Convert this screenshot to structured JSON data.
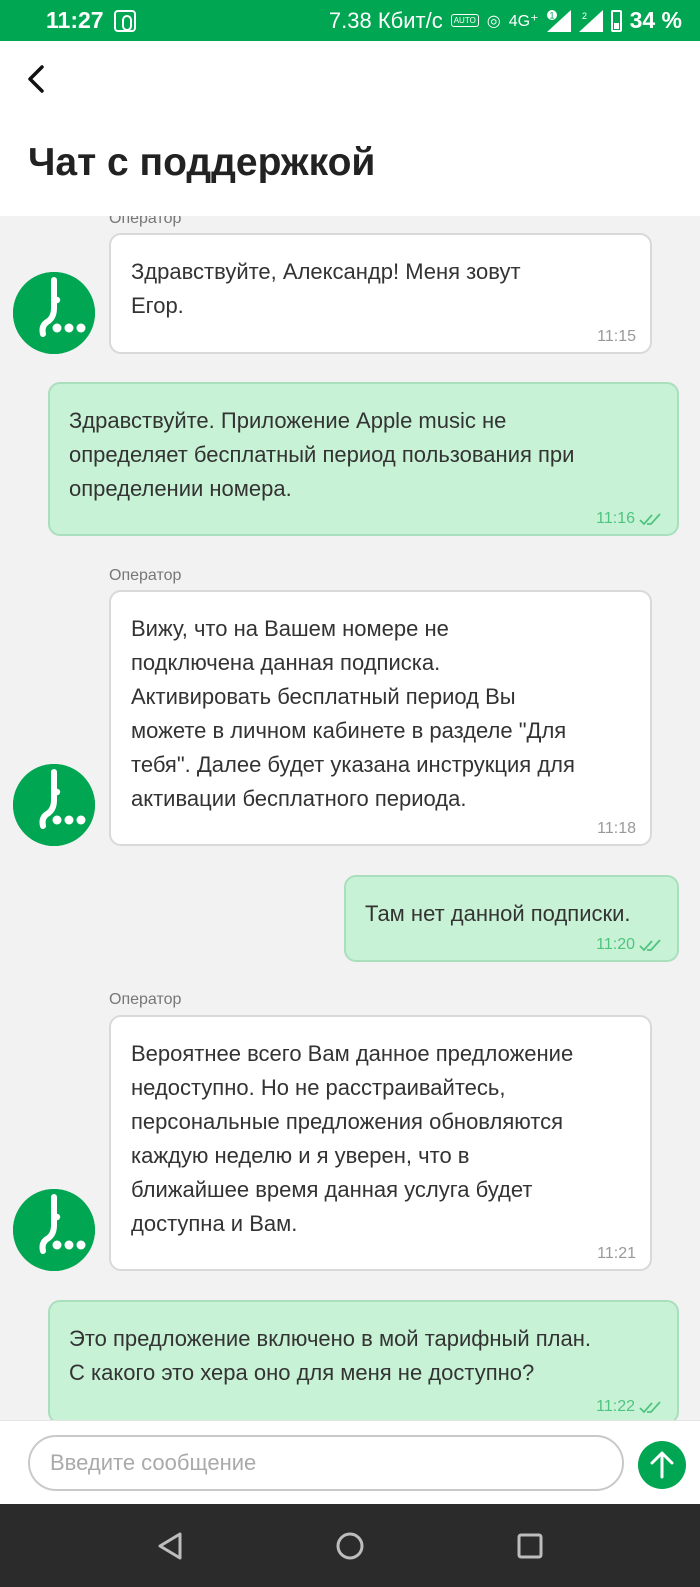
{
  "status_bar": {
    "time": "11:27",
    "speed": "7.38 Кбит/с",
    "auto_label": "AUTO",
    "network": "4G⁺",
    "sim1_badge": "1",
    "sim2_badge": "2",
    "battery": "34 %"
  },
  "header": {
    "title": "Чат с поддержкой"
  },
  "chat": {
    "operator_label": "Оператор",
    "messages": [
      {
        "from": "operator",
        "text": "Здравствуйте, Александр! Меня зовут\nЕгор.",
        "time": "11:15"
      },
      {
        "from": "me",
        "text": "Здравствуйте. Приложение Apple music не\nопределяет бесплатный период пользования при\nопределении номера.",
        "time": "11:16"
      },
      {
        "from": "operator",
        "text": "Вижу, что на Вашем номере не\nподключена данная подписка.\nАктивировать бесплатный период Вы\nможете в личном кабинете в разделе \"Для\nтебя\". Далее будет указана инструкция для\nактивации бесплатного периода.",
        "time": "11:18"
      },
      {
        "from": "me",
        "text": "Там нет данной подписки.",
        "time": "11:20"
      },
      {
        "from": "operator",
        "text": "Вероятнее всего Вам данное предложение\nнедоступно. Но не расстраивайтесь,\nперсональные предложения обновляются\nкаждую неделю и я уверен, что в\nближайшее время данная услуга будет\nдоступна и Вам.",
        "time": "11:21"
      },
      {
        "from": "me",
        "text": "Это предложение включено в мой тарифный план.\nС какого это хера оно для меня не доступно?",
        "time": "11:22"
      }
    ]
  },
  "input": {
    "placeholder": "Введите сообщение",
    "value": ""
  },
  "colors": {
    "brand_green": "#00a651",
    "my_bubble": "#c8f2d6",
    "operator_bubble": "#ffffff"
  }
}
